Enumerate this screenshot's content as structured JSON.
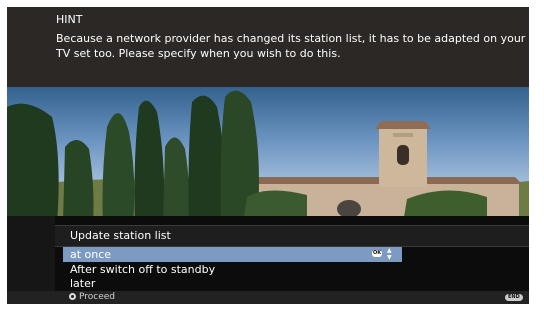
{
  "hint": {
    "title": "HINT",
    "text": "Because a network provider has changed its station list, it has to be adapted on your TV set too. Please specify when you wish to do this."
  },
  "dialog": {
    "title": "Update station list",
    "options": [
      {
        "label": "at once",
        "selected": true
      },
      {
        "label": "After switch off to standby",
        "selected": false
      },
      {
        "label": "later",
        "selected": false
      }
    ],
    "ok_badge": "OK",
    "arrows": "▲▼"
  },
  "footer": {
    "proceed": "Proceed",
    "end": "END"
  },
  "colors": {
    "selected_bg": "#7d9bc2",
    "hint_bg": "#2c2826",
    "panel_bg": "#0c0c0c"
  }
}
